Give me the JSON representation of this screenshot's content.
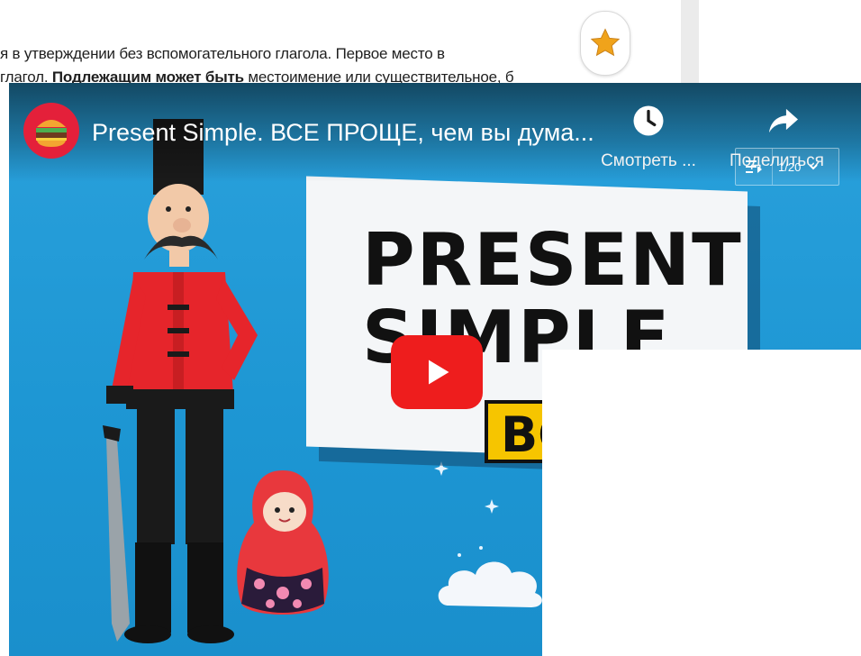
{
  "article": {
    "line1": "я в утверждении без вспомогательного глагола. Первое место в",
    "line2_prefix": "глагол. ",
    "line2_bold": "Подлежащим может быть",
    "line2_suffix": " местоимение или существительное, б"
  },
  "video": {
    "title": "Present Simple. ВСЕ ПРОЩЕ, чем вы дума...",
    "watch_later_label": "Смотреть ...",
    "share_label": "Поделиться",
    "playlist_label": "1/20",
    "thumbnail_title_line1": "PRESENT",
    "thumbnail_title_line2": "SIMPLE",
    "thumbnail_badge": "ВСЕ"
  },
  "colors": {
    "video_bg": "#1e9ad6",
    "play_button": "#ee1d1d",
    "badge": "#f6c500",
    "avatar_bg": "#e4203a"
  },
  "icons": {
    "favorite": "star-icon",
    "watch_later": "clock-icon",
    "share": "share-arrow-icon",
    "play": "play-icon",
    "playlist": "playlist-icon"
  }
}
